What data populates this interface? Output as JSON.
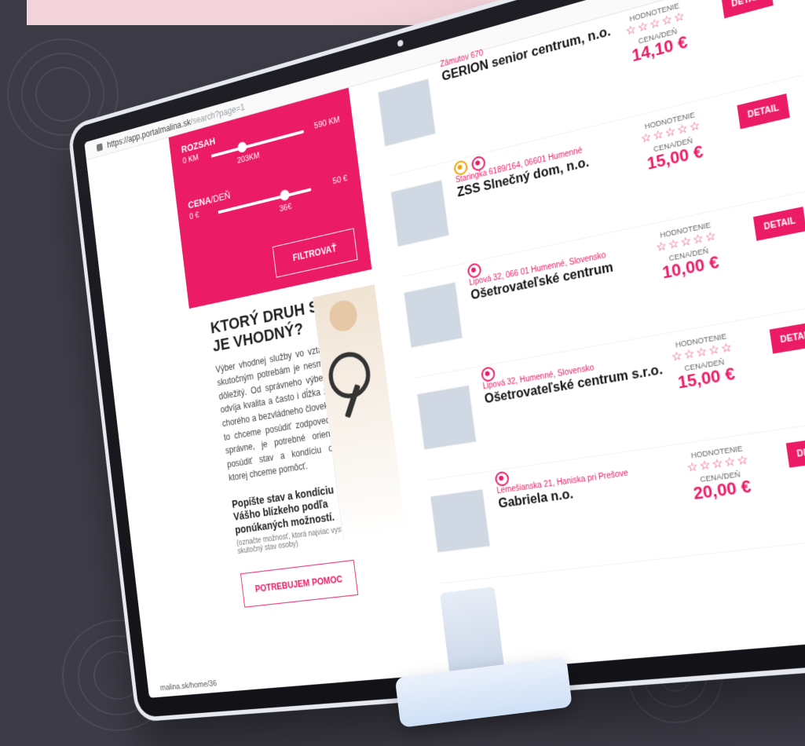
{
  "colors": {
    "accent": "#ec1b66",
    "accent2": "#f2a100",
    "bg": "#3c3b46",
    "banner": "#f3d3da"
  },
  "browser": {
    "url_host": "https://app.portalmalina.sk",
    "url_path": "/search?page=1",
    "bottom_status": "malina.sk/home/36"
  },
  "filter": {
    "range_label": "ROZSAH",
    "range_min": "0 KM",
    "range_max": "590 KM",
    "range_value": "203KM",
    "range_value_fraction": 0.34,
    "price_label_bold": "CENA",
    "price_label_regular": "/DEŇ",
    "price_min": "0 €",
    "price_max": "50 €",
    "price_value": "36€",
    "price_value_fraction": 0.72,
    "button_label": "FILTROVAŤ"
  },
  "info": {
    "title_line1": "KTORÝ DRUH SLUŽBY",
    "title_line2": "JE VHODNÝ?",
    "paragraph": "Výber vhodnej služby vo vztahu k skutočným potrebám je nesmierne dôležitý. Od správneho výberu sa odvíja kvalita a často i dĺžka života chorého a bezvládneho človeka. Ak to chceme posúdiť zodpovedne a správne, je potrebné orientačne posúdiť stav a kondíciu osoby, ktorej chceme pomôcť.",
    "lead": "Popíšte stav a kondíciu Vášho blízkeho podľa ponúkaných možností.",
    "hint": "(označte možnosť, ktorá najviac vystihuje skutočný stav osoby)",
    "cta_label": "POTREBUJEM POMOC"
  },
  "listings": [
    {
      "address": "Zámutov 670",
      "name": "GERION senior centrum, n.o.",
      "badges": [],
      "rating_header": "HODNOTENIE",
      "stars": "☆☆☆☆☆",
      "price_header": "CENA/DEŇ",
      "price": "14,10 €",
      "detail_label": "DETAIL"
    },
    {
      "address": "Staringka 6189/164, 06601 Humenné",
      "name": "ZSS Slnečný dom, n.o.",
      "badges": [
        "alt",
        "main"
      ],
      "rating_header": "HODNOTENIE",
      "stars": "☆☆☆☆☆",
      "price_header": "CENA/DEŇ",
      "price": "15,00 €",
      "detail_label": "DETAIL"
    },
    {
      "address": "Lipová 32, 066 01 Humenné, Slovensko",
      "name": "Ošetrovateľské centrum",
      "badges": [
        "main"
      ],
      "rating_header": "HODNOTENIE",
      "stars": "☆☆☆☆☆",
      "price_header": "CENA/DEŇ",
      "price": "10,00 €",
      "detail_label": "DETAIL"
    },
    {
      "address": "Lipová 32, Humenné, Slovensko",
      "name": "Ošetrovateľské centrum s.r.o.",
      "badges": [
        "main"
      ],
      "rating_header": "HODNOTENIE",
      "stars": "☆☆☆☆☆",
      "price_header": "CENA/DEŇ",
      "price": "15,00 €",
      "detail_label": "DETAIL"
    },
    {
      "address": "Lemešianska 21, Haniska pri Prešove",
      "name": "Gabriela n.o.",
      "badges": [
        "main"
      ],
      "rating_header": "HODNOTENIE",
      "stars": "☆☆☆☆☆",
      "price_header": "CENA/DEŇ",
      "price": "20,00 €",
      "detail_label": "DETAIL"
    }
  ]
}
